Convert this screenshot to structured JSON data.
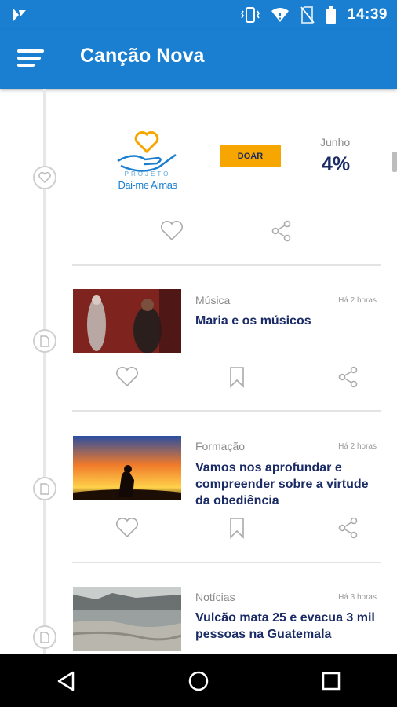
{
  "status_bar": {
    "time": "14:39"
  },
  "app_bar": {
    "title": "Canção Nova"
  },
  "donation": {
    "logo_project": "PROJETO",
    "logo_name": "Dai-me Almas",
    "button_label": "DOAR",
    "month": "Junho",
    "percent": "4%"
  },
  "articles": [
    {
      "category": "Música",
      "time": "Há 2 horas",
      "title": "Maria e os músicos"
    },
    {
      "category": "Formação",
      "time": "Há 2 horas",
      "title": "Vamos nos aprofundar e compreender sobre a virtude da obediência"
    },
    {
      "category": "Notícias",
      "time": "Há 3 horas",
      "title": "Vulcão mata 25 e evacua 3 mil pessoas na Guatemala"
    }
  ],
  "colors": {
    "primary": "#1a7fd1",
    "accent": "#f7a600",
    "headline": "#1b2b66"
  }
}
